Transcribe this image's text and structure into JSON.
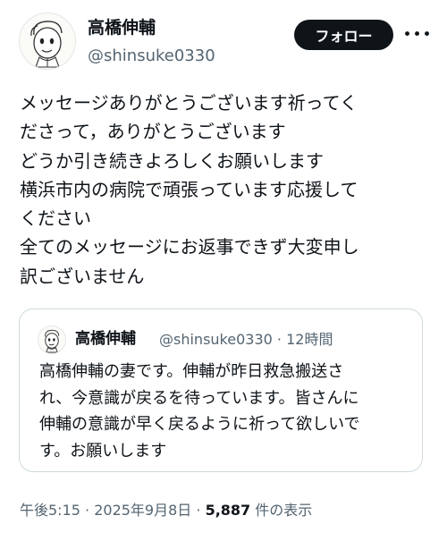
{
  "author": {
    "name": "高橋伸輔",
    "handle": "@shinsuke0330",
    "avatar_icon": "cartoon-face-avatar"
  },
  "follow_label": "フォロー",
  "more_label": "•••",
  "tweet": {
    "text": "メッセージありがとうございます祈ってく\nださって，ありがとうございます\nどうか引き続きよろしくお願いします\n横浜市内の病院で頑張っています応援して\nください\n全てのメッセージにお返事できず大変申し\n訳ございません"
  },
  "quoted": {
    "name": "高橋伸輔",
    "handle": "@shinsuke0330",
    "separator": "·",
    "time": "12時間",
    "text": "高橋伸輔の妻です。伸輔が昨日救急搬送さ\nれ、今意識が戻るを待っています。皆さんに\n伸輔の意識が早く戻るように祈って欲しいで\nす。お願いします"
  },
  "footer": {
    "time": "午後5:15",
    "sep1": " · ",
    "date": "2025年9月8日",
    "sep2": " · ",
    "views": "5,887",
    "views_suffix": " 件の表示"
  },
  "colors": {
    "text": "#0f1419",
    "secondary": "#536471",
    "follow_bg": "#0f1419",
    "border": "#cfd9de"
  }
}
